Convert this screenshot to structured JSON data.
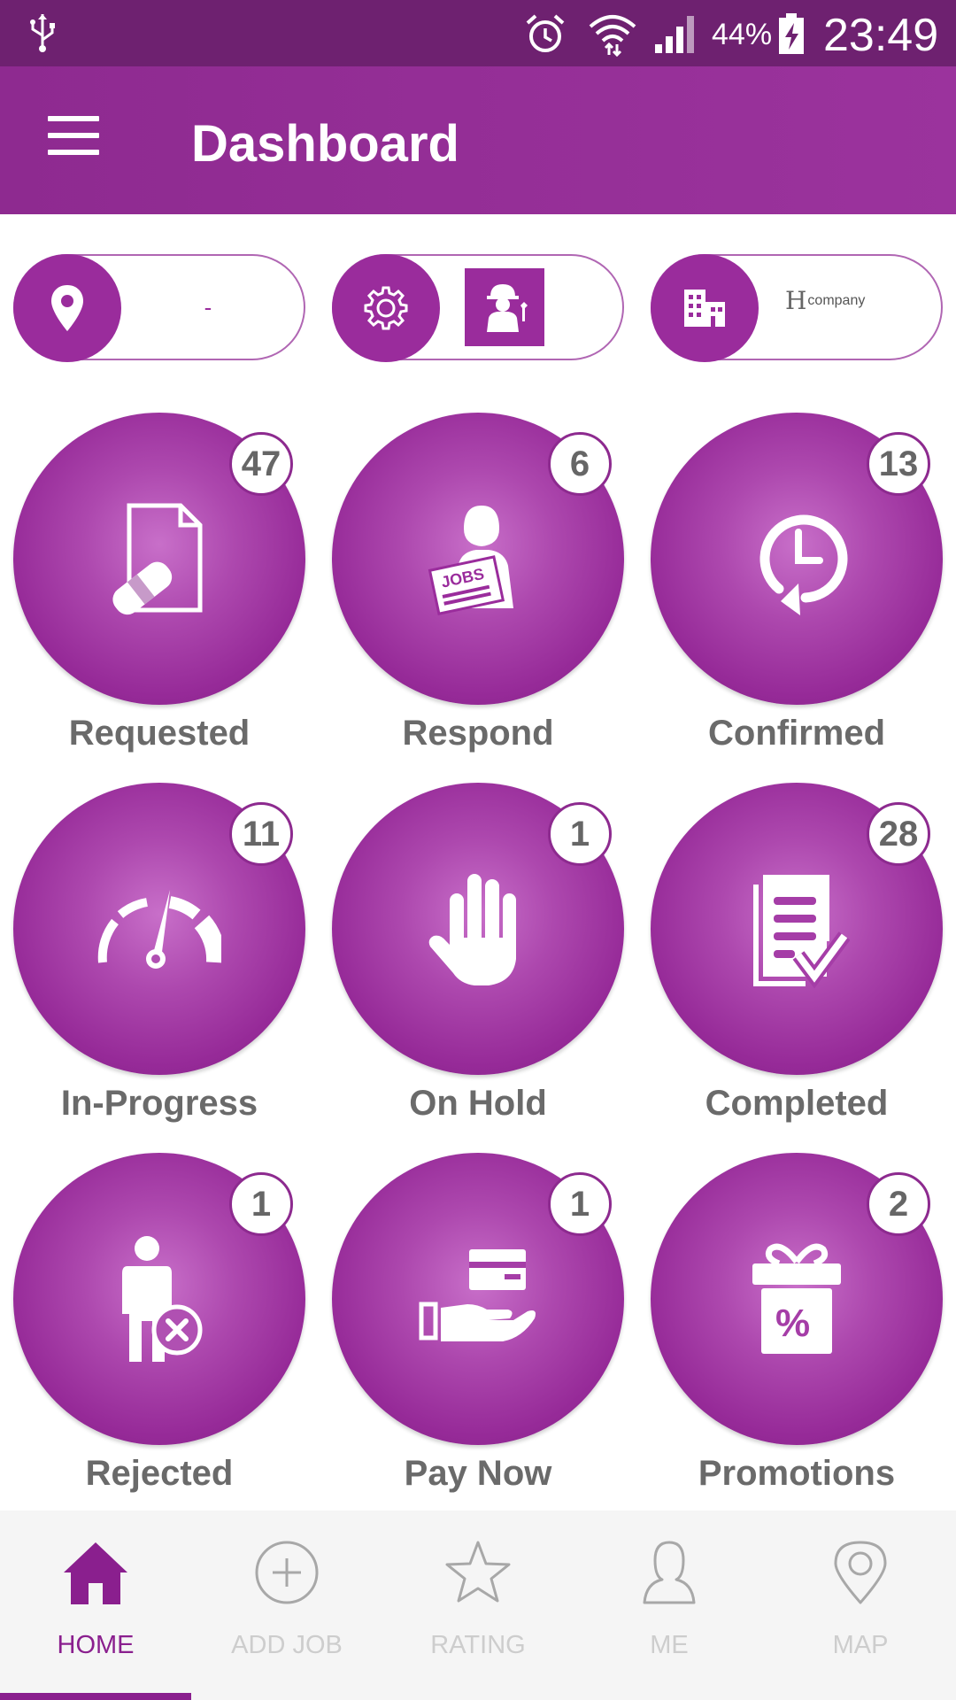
{
  "status_bar": {
    "battery_percent": "44%",
    "time": "23:49"
  },
  "app_bar": {
    "title": "Dashboard"
  },
  "selectors": {
    "location_value": "-",
    "company_value": "company",
    "company_logo_letter": "H"
  },
  "tiles": [
    {
      "label": "Requested",
      "count": "47",
      "icon": "document-plaster-icon"
    },
    {
      "label": "Respond",
      "count": "6",
      "icon": "worker-jobs-sign-icon"
    },
    {
      "label": "Confirmed",
      "count": "13",
      "icon": "clock-refresh-icon"
    },
    {
      "label": "In-Progress",
      "count": "11",
      "icon": "speedometer-icon"
    },
    {
      "label": "On Hold",
      "count": "1",
      "icon": "hand-stop-icon"
    },
    {
      "label": "Completed",
      "count": "28",
      "icon": "checklist-icon"
    },
    {
      "label": "Rejected",
      "count": "1",
      "icon": "person-rejected-icon"
    },
    {
      "label": "Pay Now",
      "count": "1",
      "icon": "hand-card-icon"
    },
    {
      "label": "Promotions",
      "count": "2",
      "icon": "gift-percent-icon"
    }
  ],
  "bottom_nav": [
    {
      "label": "HOME",
      "icon": "home-icon",
      "active": true
    },
    {
      "label": "ADD JOB",
      "icon": "add-circle-icon",
      "active": false
    },
    {
      "label": "RATING",
      "icon": "star-icon",
      "active": false
    },
    {
      "label": "ME",
      "icon": "person-icon",
      "active": false
    },
    {
      "label": "MAP",
      "icon": "map-pin-icon",
      "active": false
    }
  ],
  "colors": {
    "primary": "#9a2c9c",
    "status_bar": "#6e2170",
    "active_nav": "#8a1f8e",
    "inactive_nav": "#cdcdcd",
    "label_text": "#6a6a6a"
  }
}
